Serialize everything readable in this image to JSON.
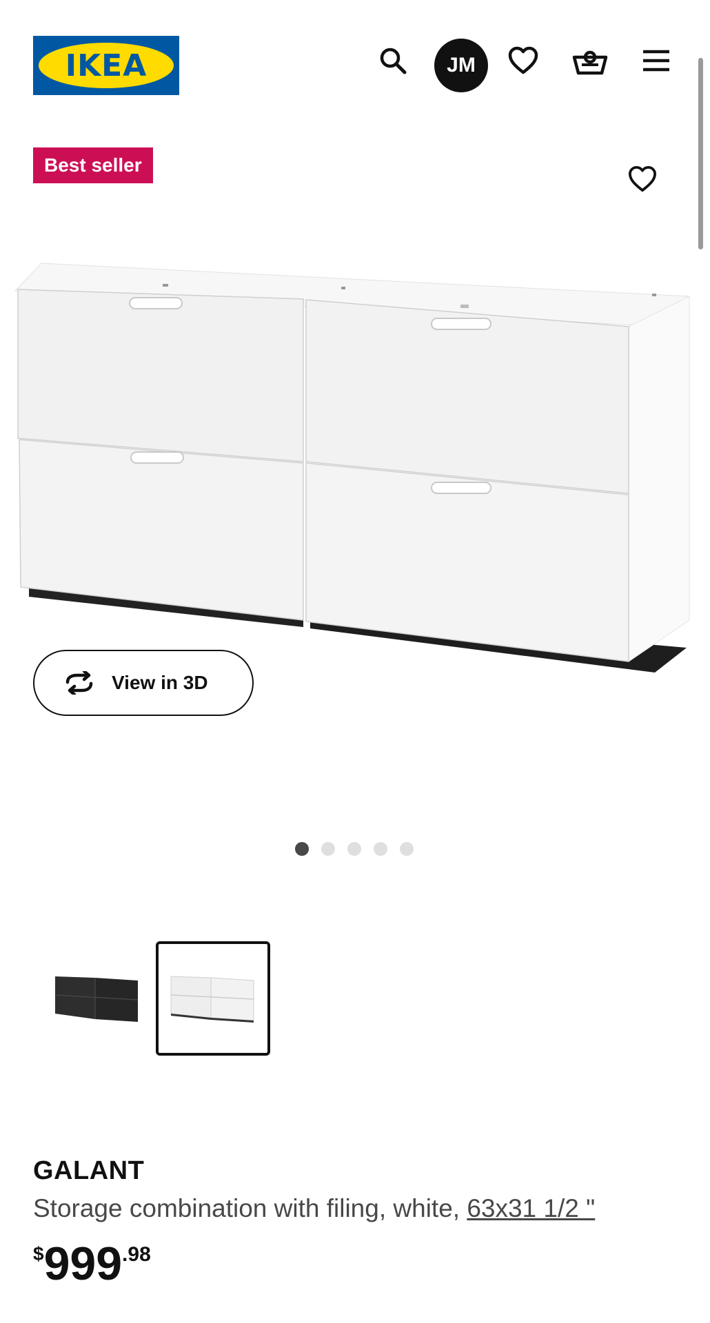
{
  "header": {
    "logo_text": "IKEA",
    "avatar_initials": "JM",
    "icons": [
      "search-icon",
      "heart-icon",
      "basket-icon",
      "menu-icon"
    ]
  },
  "product": {
    "badge": "Best seller",
    "view3d_label": "View in 3D",
    "carousel": {
      "count": 5,
      "active": 1
    },
    "thumbnails": [
      {
        "variant": "black-brown",
        "color": "#2b2b2b"
      },
      {
        "variant": "white",
        "color": "#f2f2f2",
        "selected": true
      }
    ],
    "name": "GALANT",
    "description": "Storage combination with filing, white, ",
    "size": "63x31 1/2 \"",
    "price": {
      "currency": "$",
      "integer": "999",
      "decimal": ".98"
    }
  },
  "colors": {
    "ikea_blue": "#0058a3",
    "ikea_yellow": "#ffdb00",
    "badge_red": "#cc0f55",
    "text_dark": "#111111",
    "text_gray": "#484848"
  }
}
